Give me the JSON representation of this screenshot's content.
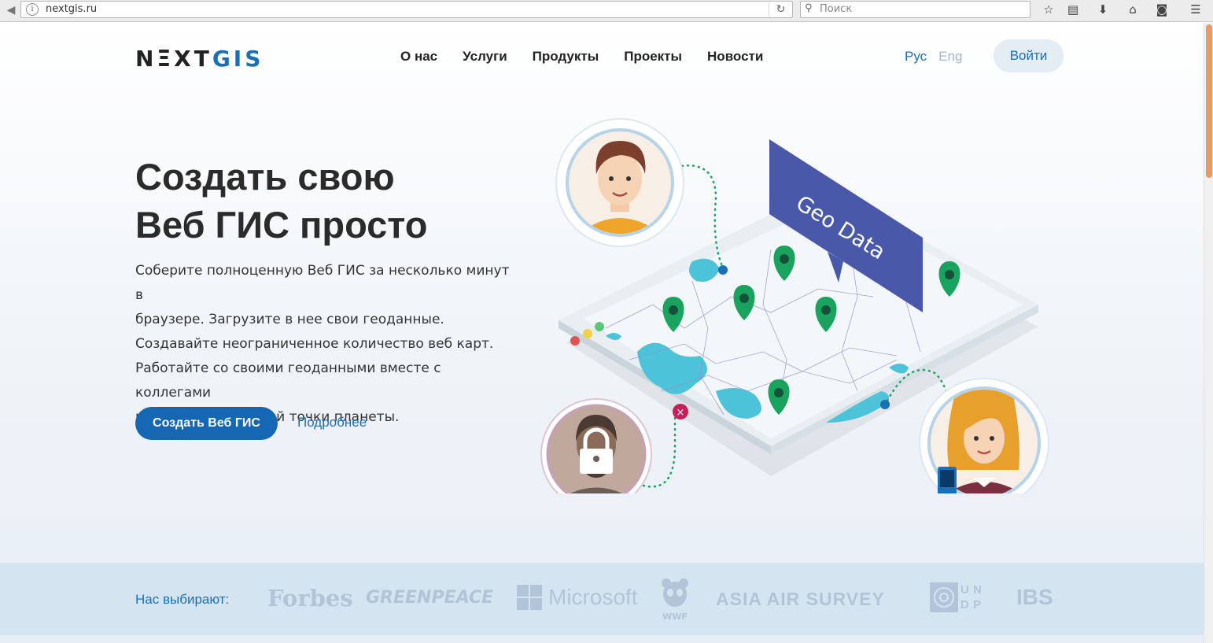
{
  "browser": {
    "url": "nextgis.ru",
    "search_placeholder": "Поиск"
  },
  "header": {
    "logo_main": "NΞXT",
    "logo_accent": "GIS",
    "nav": [
      "О нас",
      "Услуги",
      "Продукты",
      "Проекты",
      "Новости"
    ],
    "lang_active": "Рус",
    "lang_inactive": "Eng",
    "login": "Войти"
  },
  "hero": {
    "title_line1": "Создать свою",
    "title_line2": "Веб ГИС просто",
    "text_lines": [
      "Соберите полноценную Веб ГИС за несколько минут в",
      "браузере. Загрузите в нее свои геоданные.",
      "Создавайте неограниченное количество веб карт.",
      "Работайте со своими геоданными вместе с коллегами",
      "и друзьями из любой точки планеты."
    ],
    "cta": "Создать Веб ГИС",
    "more": "Подробнее",
    "banner_text": "Geo Data"
  },
  "clients": {
    "label": "Нас выбирают:",
    "logos": [
      "Forbes",
      "GREENPEACE",
      "Microsoft",
      "WWF",
      "ASIA AIR SURVEY",
      "U N D P",
      "IBS"
    ]
  },
  "colors": {
    "brand_blue": "#1567b4",
    "pin_green": "#1aa35e",
    "water": "#4cc3d9",
    "banner": "#4958a8"
  }
}
